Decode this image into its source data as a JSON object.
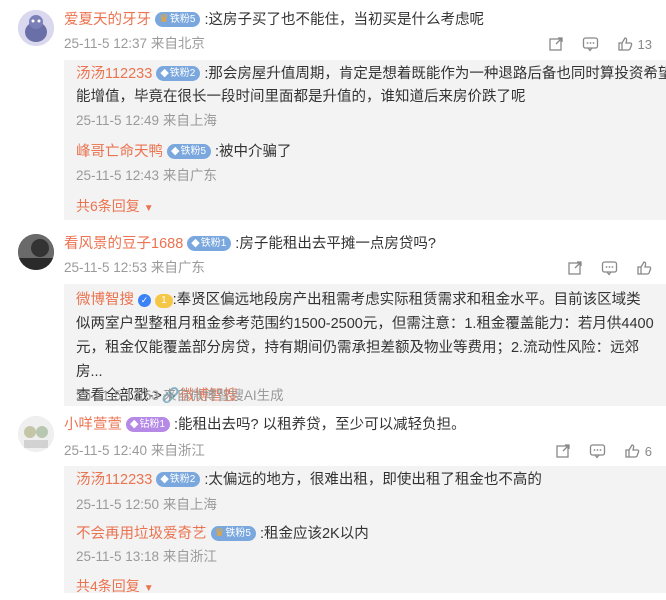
{
  "comments": [
    {
      "user": "爱夏天的牙牙",
      "badge": "铁粉5",
      "text": ":这房子买了也不能住，当初买是什么考虑呢",
      "meta": "25-11-5 12:37 来自北京",
      "likes": "13",
      "replies": [
        {
          "user": "汤汤112233",
          "badge": "铁粉2",
          "text": ":那会房屋升值周期，肯定是想着既能作为一种退路后备也同时算投资希望",
          "text2": "能增值，毕竟在很长一段时间里面都是升值的，谁知道后来房价跌了呢",
          "meta": "25-11-5 12:49 来自上海"
        },
        {
          "user": "峰哥亡命天鸭",
          "badge": "铁粉5",
          "text": ":被中介骗了",
          "meta": "25-11-5 12:43 来自广东"
        }
      ],
      "more": "共6条回复"
    },
    {
      "user": "看风景的豆子1688",
      "badge": "铁粉1",
      "text": ":房子能租出去平摊一点房贷吗?",
      "meta": "25-11-5 12:53 来自广东",
      "likes": "",
      "ai_reply": {
        "user": "微博智搜",
        "level": "1",
        "lines": [
          ":奉贤区偏远地段房产出租需考虑实际租赁需求和租金水平。目前该区域类",
          "似两室户型整租月租金参考范围约1500-2500元，但需注意：1.租金覆盖能力：若月供4400",
          "元，租金仅能覆盖部分房贷，持有期间仍需承担差额及物业等费用；2.流动性风险：远郊房..."
        ],
        "view_all": "查看全部戳->",
        "link": "微博智搜",
        "meta": "25-11-5 12:53 来自微博智搜AI生成"
      }
    },
    {
      "user": "小咩萱萱",
      "badge": "钻粉1",
      "text": ":能租出去吗? 以租养贷，至少可以减轻负担。",
      "meta": "25-11-5 12:40 来自浙江",
      "likes": "6",
      "replies": [
        {
          "user": "汤汤112233",
          "badge": "铁粉2",
          "text": ":太偏远的地方，很难出租，即使出租了租金也不高的",
          "meta": "25-11-5 12:50 来自上海"
        },
        {
          "user": "不会再用垃圾爱奇艺",
          "badge": "铁粉5",
          "text": ":租金应该2K以内",
          "meta": "25-11-5 13:18 来自浙江"
        }
      ],
      "more": "共4条回复"
    }
  ]
}
